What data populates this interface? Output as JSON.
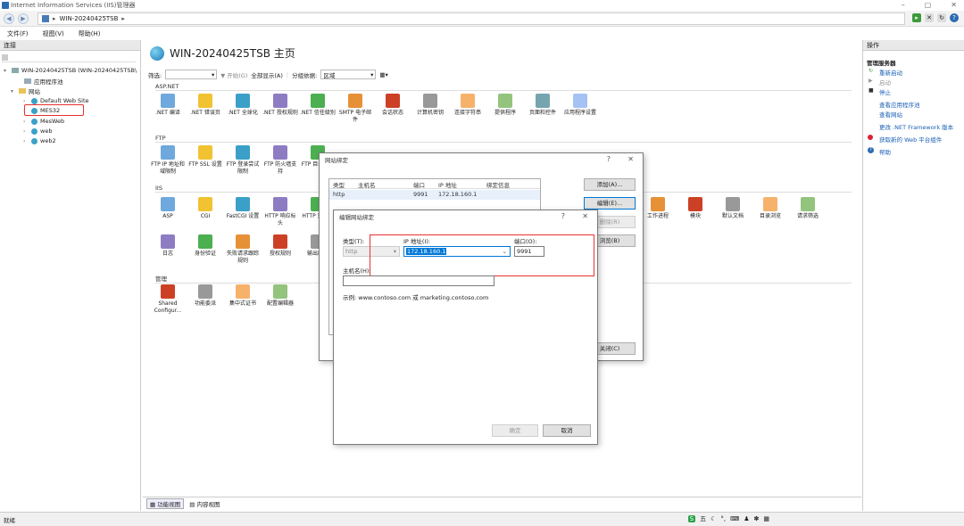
{
  "window": {
    "title": "Internet Information Services (IIS)管理器"
  },
  "address": {
    "path_server": "WIN-20240425TSB",
    "sep": "▸"
  },
  "menu": {
    "items": [
      "文件(F)",
      "视图(V)",
      "帮助(H)"
    ]
  },
  "left_panel": {
    "header": "连接",
    "tree": [
      {
        "label": "WIN-20240425TSB (WIN-20240425TSB\\"
      },
      {
        "label": "应用程序池"
      },
      {
        "label": "网站"
      },
      {
        "label": "Default Web Site"
      },
      {
        "label": "MES32"
      },
      {
        "label": "MesWeb"
      },
      {
        "label": "web"
      },
      {
        "label": "web2"
      }
    ]
  },
  "center": {
    "title": "WIN-20240425TSB 主页",
    "filter": {
      "label": "筛选:",
      "start": "▼ 开始(G)",
      "showall": "全部显示(A)",
      "groupby_label": "分组依据:",
      "groupby_value": "区域"
    },
    "sections": {
      "aspnet": "ASP.NET",
      "ftp": "FTP",
      "iis": "IIS",
      "manage": "管理"
    },
    "aspnet_features": [
      ".NET 编译",
      ".NET 错误页",
      ".NET 全球化",
      ".NET 授权规则",
      ".NET 信任级别",
      "SMTP 电子邮件",
      "会话状态",
      "计算机密钥",
      "连接字符串",
      "提供程序",
      "页面和控件",
      "应用程序设置"
    ],
    "ftp_features": [
      "FTP IP 地址和域限制",
      "FTP SSL 设置",
      "FTP 登录尝试限制",
      "FTP 防火墙支持",
      "FTP 目录浏览"
    ],
    "iis_features": [
      "ASP",
      "CGI",
      "FastCGI 设置",
      "HTTP 响应标头",
      "HTTP 重定向"
    ],
    "iis_features_right": [
      "工作进程",
      "模块",
      "默认文档",
      "目录浏览",
      "请求筛选"
    ],
    "iis_row2": [
      "日志",
      "身份验证",
      "失败请求跟踪规则",
      "授权规则",
      "输出缓存"
    ],
    "manage_features": [
      "Shared Configur...",
      "功能委派",
      "集中式证书",
      "配置编辑器"
    ],
    "view_tabs": [
      "功能视图",
      "内容视图"
    ]
  },
  "right_panel": {
    "header": "操作",
    "group_title": "管理服务器",
    "actions": [
      "重新启动",
      "启动",
      "停止",
      "查看应用程序池",
      "查看网站",
      "更改 .NET Framework 版本",
      "获取新的 Web 平台组件",
      "帮助"
    ]
  },
  "bindings_dialog": {
    "title": "网站绑定",
    "headers": [
      "类型",
      "主机名",
      "端口",
      "IP 地址",
      "绑定信息"
    ],
    "rows": [
      {
        "type": "http",
        "host": "",
        "port": "9991",
        "ip": "172.18.160.1",
        "info": ""
      }
    ],
    "buttons": {
      "add": "添加(A)...",
      "edit": "编辑(E)...",
      "remove": "删除(R)",
      "browse": "浏览(B)",
      "close": "关闭(C)"
    }
  },
  "edit_dialog": {
    "title": "编辑网站绑定",
    "type_label": "类型(T):",
    "type_value": "http",
    "ip_label": "IP 地址(I):",
    "ip_value": "172.18.160.1",
    "port_label": "端口(O):",
    "port_value": "9991",
    "host_label": "主机名(H):",
    "host_value": "",
    "example": "示例: www.contoso.com 或 marketing.contoso.com",
    "ok": "确定",
    "cancel": "取消"
  },
  "status": {
    "text": "就绪"
  },
  "ime": {
    "label": "五"
  },
  "colors": {
    "accent": "#0078d7",
    "highlight": "#e8312f",
    "link": "#1a5fb4"
  }
}
